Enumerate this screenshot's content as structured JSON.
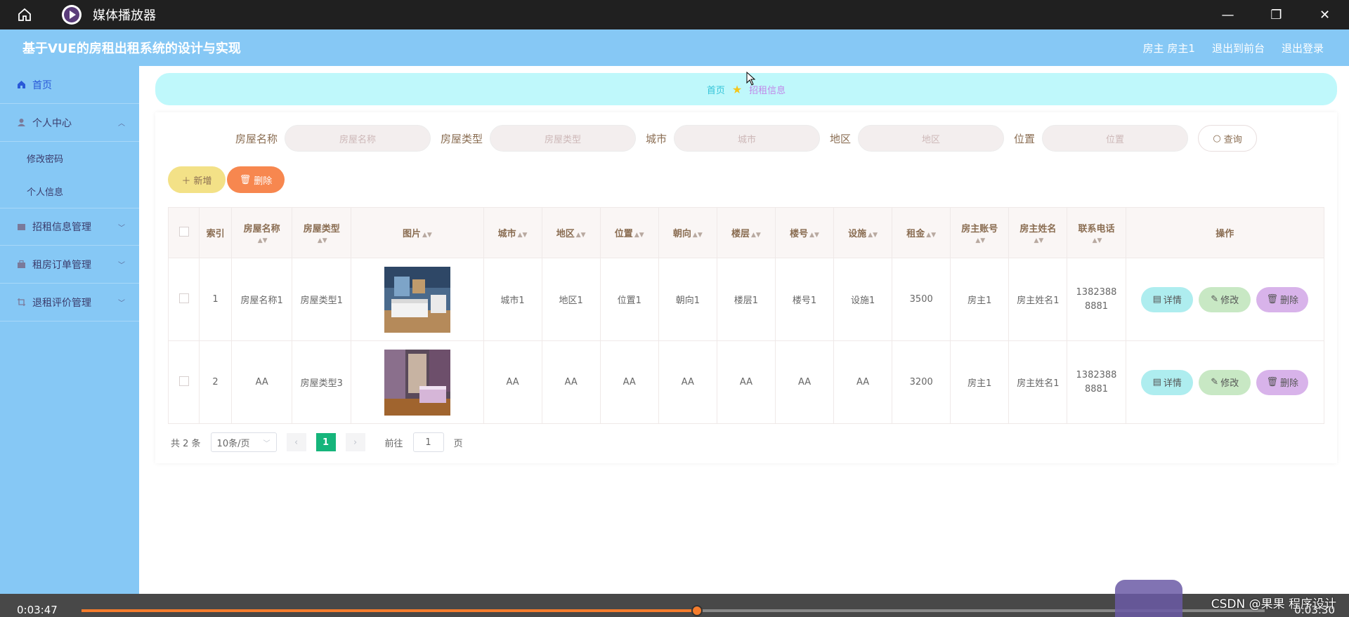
{
  "player": {
    "title": "媒体播放器",
    "time_elapsed": "0:03:47",
    "time_remaining": "0:03:30",
    "progress_fraction": 0.52,
    "watermark": "CSDN @果果 程序设计"
  },
  "header": {
    "system_title": "基于VUE的房租出租系统的设计与实现",
    "user_label": "房主 房主1",
    "to_backend": "退出到前台",
    "logout": "退出登录"
  },
  "sidebar": {
    "home": "首页",
    "personal_center": "个人中心",
    "change_password": "修改密码",
    "personal_info": "个人信息",
    "rental_info_mgmt": "招租信息管理",
    "rental_order_mgmt": "租房订单管理",
    "checkout_review_mgmt": "退租评价管理"
  },
  "breadcrumb": {
    "home": "首页",
    "current": "招租信息"
  },
  "search": {
    "house_name_label": "房屋名称",
    "house_name_placeholder": "房屋名称",
    "house_type_label": "房屋类型",
    "house_type_placeholder": "房屋类型",
    "city_label": "城市",
    "city_placeholder": "城市",
    "district_label": "地区",
    "district_placeholder": "地区",
    "location_label": "位置",
    "location_placeholder": "位置",
    "query_button": "查询"
  },
  "actions": {
    "add": "新增",
    "delete": "删除"
  },
  "table": {
    "headers": {
      "index": "索引",
      "house_name": "房屋名称",
      "house_type": "房屋类型",
      "image": "图片",
      "city": "城市",
      "district": "地区",
      "location": "位置",
      "orientation": "朝向",
      "floor": "楼层",
      "building": "楼号",
      "facilities": "设施",
      "rent": "租金",
      "owner_account": "房主账号",
      "owner_name": "房主姓名",
      "phone": "联系电话",
      "operations": "操作"
    },
    "rows": [
      {
        "index": "1",
        "house_name": "房屋名称1",
        "house_type": "房屋类型1",
        "city": "城市1",
        "district": "地区1",
        "location": "位置1",
        "orientation": "朝向1",
        "floor": "楼层1",
        "building": "楼号1",
        "facilities": "设施1",
        "rent": "3500",
        "owner_account": "房主1",
        "owner_name": "房主姓名1",
        "phone": "13823888881"
      },
      {
        "index": "2",
        "house_name": "AA",
        "house_type": "房屋类型3",
        "city": "AA",
        "district": "AA",
        "location": "AA",
        "orientation": "AA",
        "floor": "AA",
        "building": "AA",
        "facilities": "AA",
        "rent": "3200",
        "owner_account": "房主1",
        "owner_name": "房主姓名1",
        "phone": "13823888881"
      }
    ],
    "op_detail": "详情",
    "op_edit": "修改",
    "op_delete": "删除"
  },
  "pagination": {
    "total": "共 2 条",
    "page_size": "10条/页",
    "current_page": "1",
    "goto_prefix": "前往",
    "goto_value": "1",
    "goto_suffix": "页"
  }
}
